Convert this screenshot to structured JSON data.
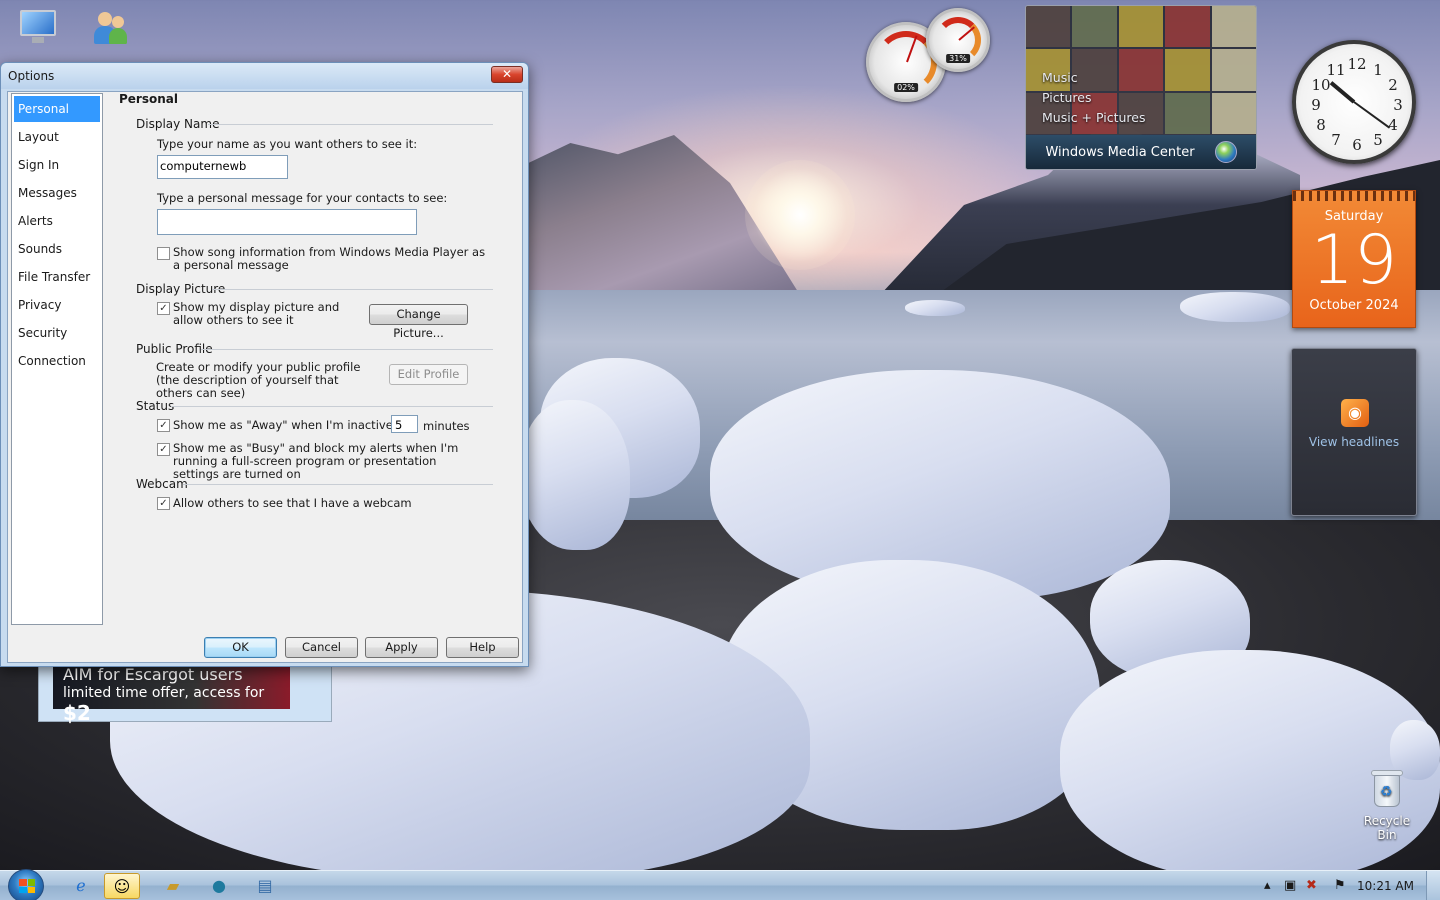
{
  "desktop": {
    "icons": [
      {
        "name": "computer-icon",
        "label": ""
      },
      {
        "name": "messenger-shortcut-icon",
        "label": ""
      },
      {
        "name": "recycle-bin-icon",
        "label": "Recycle Bin"
      }
    ]
  },
  "gadgets": {
    "cpu_meter": {
      "cpu": "02%",
      "memory": "31%"
    },
    "media_center": {
      "menu": [
        "Music",
        "Pictures",
        "Music + Pictures"
      ],
      "brand": "Windows Media Center"
    },
    "clock": {
      "numbers": [
        "12",
        "1",
        "2",
        "3",
        "4",
        "5",
        "6",
        "7",
        "8",
        "9",
        "10",
        "11"
      ],
      "time": "10:21"
    },
    "calendar": {
      "day_of_week": "Saturday",
      "day": "19",
      "month_year": "October 2024"
    },
    "feeds": {
      "link": "View headlines",
      "icon": "rss-icon"
    }
  },
  "ad": {
    "line1": "AIM for Escargot users",
    "line2": "limited time offer, access for",
    "price": "$2"
  },
  "dialog": {
    "title": "Options",
    "close_glyph": "✕",
    "nav": [
      "Personal",
      "Layout",
      "Sign In",
      "Messages",
      "Alerts",
      "Sounds",
      "File Transfer",
      "Privacy",
      "Security",
      "Connection"
    ],
    "selected_nav": "Personal",
    "pane_title": "Personal",
    "display_name": {
      "group": "Display Name",
      "name_label": "Type your name as you want others to see it:",
      "name_value": "computernewb",
      "message_label": "Type a personal message for your contacts to see:",
      "message_value": "",
      "song_label": "Show song information from Windows Media Player as a personal message",
      "song_checked": false
    },
    "display_picture": {
      "group": "Display Picture",
      "show_label": "Show my display picture and allow others to see it",
      "show_checked": true,
      "change_button": "Change Picture..."
    },
    "public_profile": {
      "group": "Public Profile",
      "text": "Create or modify your public profile (the description of yourself that others can see)",
      "edit_button": "Edit Profile"
    },
    "status": {
      "group": "Status",
      "away_label": "Show me as \"Away\" when I'm inactive for",
      "away_checked": true,
      "away_minutes": "5",
      "minutes_label": "minutes",
      "busy_label": "Show me as \"Busy\" and block my alerts when I'm running a full-screen program or presentation settings are turned on",
      "busy_checked": true
    },
    "webcam": {
      "group": "Webcam",
      "allow_label": "Allow others to see that I have a webcam",
      "allow_checked": true
    },
    "buttons": {
      "ok": "OK",
      "cancel": "Cancel",
      "apply": "Apply",
      "help": "Help"
    }
  },
  "taskbar": {
    "time": "10:21 AM",
    "pinned": [
      "internet-explorer-icon",
      "messenger-icon",
      "explorer-folder-icon",
      "media-player-icon",
      "notepad-icon"
    ]
  },
  "colors": {
    "selection": "#3399ff",
    "calendar": "#e8641b",
    "window_frame": "#c7dbef"
  }
}
